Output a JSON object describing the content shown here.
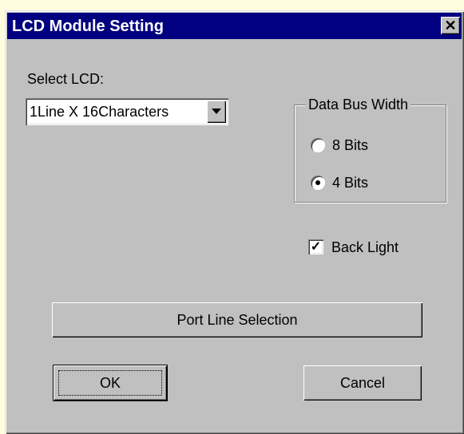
{
  "dialog": {
    "title": "LCD Module Setting",
    "close_glyph": "✕"
  },
  "select_lcd": {
    "label": "Select LCD:",
    "value": "1Line X 16Characters"
  },
  "data_bus": {
    "legend": "Data Bus Width",
    "options": [
      {
        "label": "8 Bits",
        "checked": false
      },
      {
        "label": "4 Bits",
        "checked": true
      }
    ]
  },
  "back_light": {
    "label": "Back Light",
    "checked": true,
    "check_glyph": "✓"
  },
  "buttons": {
    "port_line": "Port Line Selection",
    "ok": "OK",
    "cancel": "Cancel"
  },
  "colors": {
    "titlebar": "#000080",
    "face": "#c0c0c0",
    "desktop": "#fffde0"
  }
}
